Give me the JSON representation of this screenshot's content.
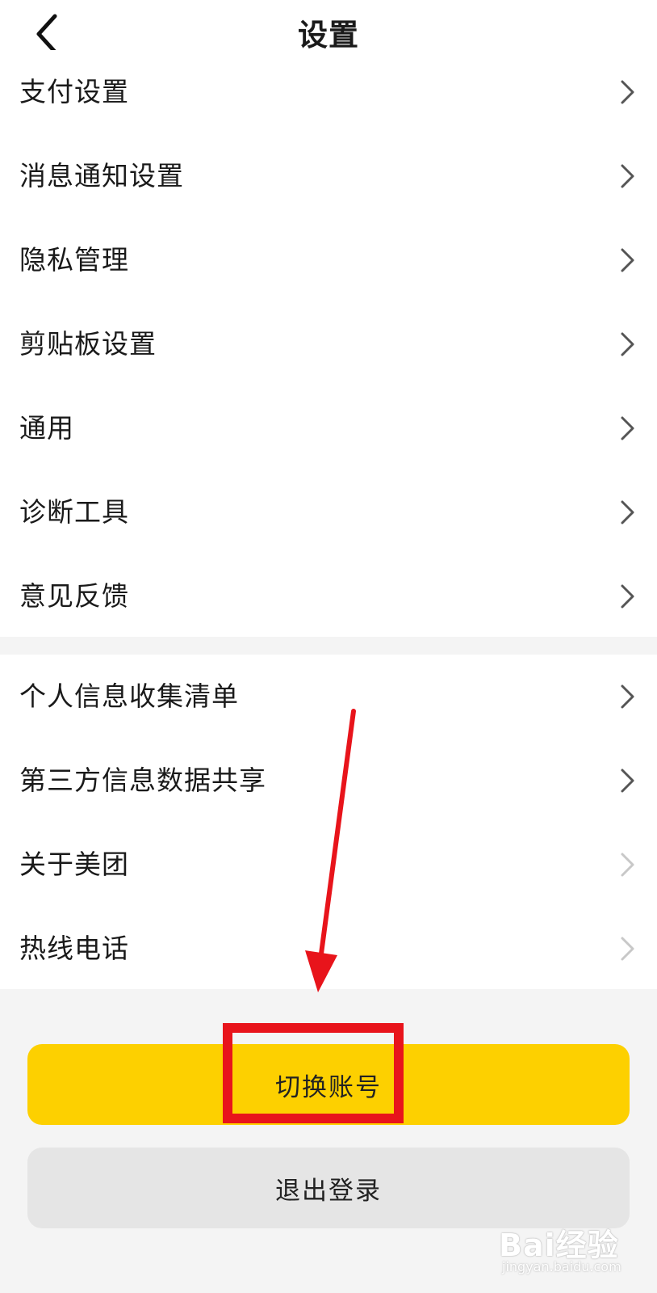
{
  "header": {
    "title": "设置",
    "back_icon": "chevron-left-icon"
  },
  "menu": {
    "section_1": [
      {
        "label": "支付设置"
      },
      {
        "label": "消息通知设置"
      },
      {
        "label": "隐私管理"
      },
      {
        "label": "剪贴板设置"
      },
      {
        "label": "通用"
      },
      {
        "label": "诊断工具"
      },
      {
        "label": "意见反馈"
      }
    ],
    "section_2": [
      {
        "label": "个人信息收集清单"
      },
      {
        "label": "第三方信息数据共享"
      },
      {
        "label": "关于美团"
      },
      {
        "label": "热线电话"
      }
    ]
  },
  "buttons": {
    "switch_account": "切换账号",
    "logout": "退出登录"
  },
  "annotation": {
    "arrow_color": "#e8141b",
    "highlight_color": "#e8141b"
  },
  "watermark": {
    "brand": "Bai经验",
    "domain": "jingyan.baidu.com"
  },
  "colors": {
    "primary_button": "#fdd000",
    "secondary_button": "#e5e5e5",
    "background": "#f4f4f4",
    "text": "#1a1a1a"
  }
}
